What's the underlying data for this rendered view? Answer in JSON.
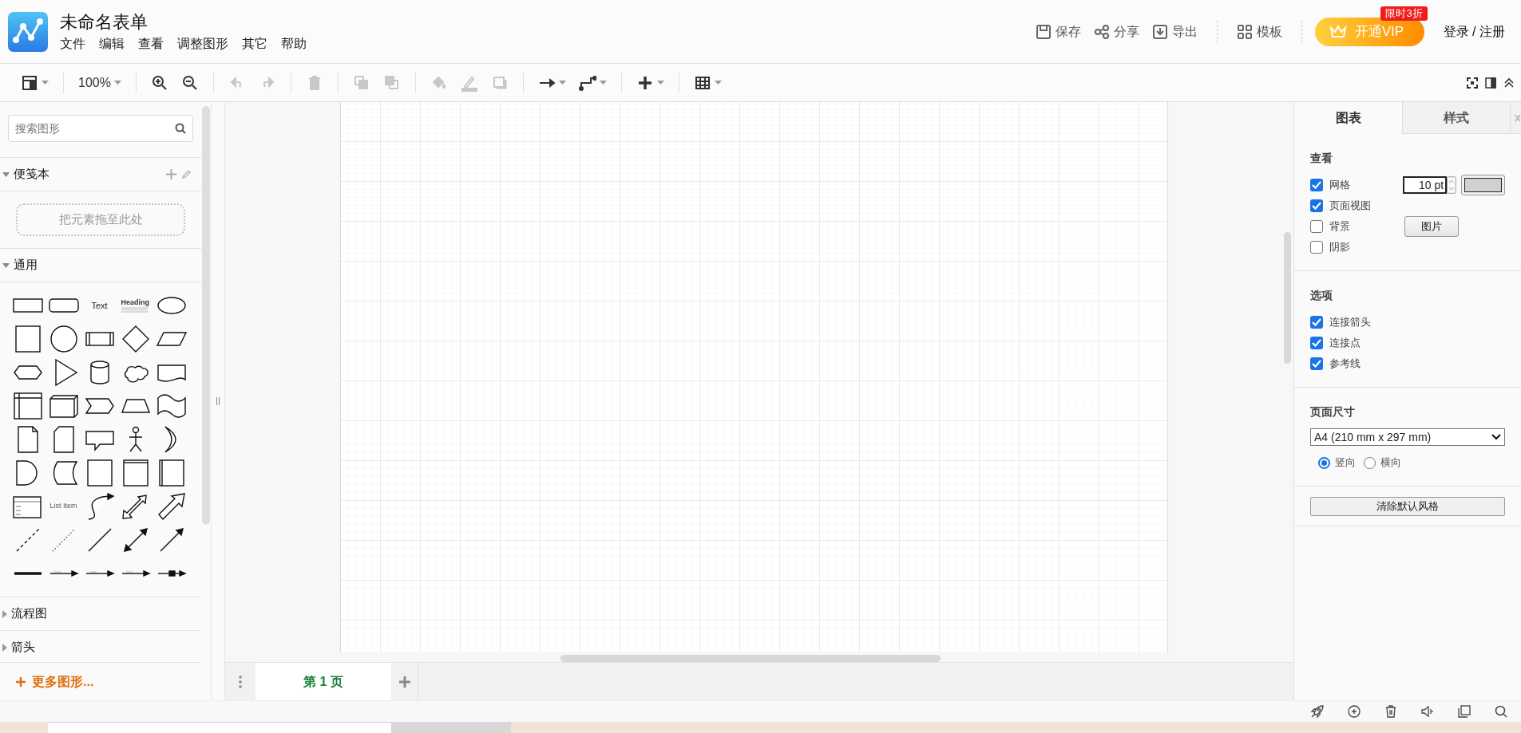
{
  "app": {
    "title": "未命名表单"
  },
  "menu": [
    "文件",
    "编辑",
    "查看",
    "调整图形",
    "其它",
    "帮助"
  ],
  "header_actions": [
    {
      "kind": "save",
      "label": "保存"
    },
    {
      "kind": "share",
      "label": "分享"
    },
    {
      "kind": "export",
      "label": "导出"
    },
    {
      "kind": "templates",
      "label": "模板"
    }
  ],
  "vip_button": {
    "label": "开通VIP",
    "badge": "限时3折"
  },
  "login": "登录 / 注册",
  "toolbar": [
    {
      "kind": "layout",
      "disabled": false
    },
    {
      "kind": "separator"
    },
    {
      "kind": "zoom",
      "label": "100%",
      "disabled": false
    },
    {
      "kind": "separator"
    },
    {
      "kind": "zoomin",
      "disabled": false
    },
    {
      "kind": "zoomout",
      "disabled": false
    },
    {
      "kind": "separator"
    },
    {
      "kind": "undo",
      "disabled": true
    },
    {
      "kind": "redo",
      "disabled": true
    },
    {
      "kind": "separator"
    },
    {
      "kind": "delete",
      "disabled": true
    },
    {
      "kind": "separator"
    },
    {
      "kind": "tofront",
      "disabled": true
    },
    {
      "kind": "toback",
      "disabled": true
    },
    {
      "kind": "separator"
    },
    {
      "kind": "fill",
      "disabled": true
    },
    {
      "kind": "linecolor",
      "disabled": true
    },
    {
      "kind": "shadow",
      "disabled": true
    },
    {
      "kind": "separator"
    },
    {
      "kind": "connection",
      "disabled": false
    },
    {
      "kind": "waypoints",
      "disabled": false
    },
    {
      "kind": "separator"
    },
    {
      "kind": "insert",
      "disabled": false
    },
    {
      "kind": "separator"
    },
    {
      "kind": "table",
      "disabled": false
    }
  ],
  "sidebar": {
    "search_placeholder": "搜索图形",
    "sections": [
      {
        "kind": "scratchpad",
        "title": "便笺本",
        "expanded": true,
        "drop_hint": "把元素拖至此处"
      },
      {
        "kind": "shapes",
        "title": "通用",
        "expanded": true,
        "shapes": [
          {
            "kind": "rect"
          },
          {
            "kind": "rounded"
          },
          {
            "kind": "text",
            "label": "Text"
          },
          {
            "kind": "heading",
            "label": "Heading"
          },
          {
            "kind": "ellipse"
          },
          {
            "kind": "square"
          },
          {
            "kind": "circle"
          },
          {
            "kind": "process"
          },
          {
            "kind": "diamond"
          },
          {
            "kind": "parallelogram"
          },
          {
            "kind": "hexagon"
          },
          {
            "kind": "triangle"
          },
          {
            "kind": "cylinder"
          },
          {
            "kind": "cloud"
          },
          {
            "kind": "document"
          },
          {
            "kind": "internal"
          },
          {
            "kind": "cube"
          },
          {
            "kind": "step"
          },
          {
            "kind": "trapezoid"
          },
          {
            "kind": "tape"
          },
          {
            "kind": "note"
          },
          {
            "kind": "card"
          },
          {
            "kind": "callout"
          },
          {
            "kind": "actor"
          },
          {
            "kind": "or"
          },
          {
            "kind": "and"
          },
          {
            "kind": "storage"
          },
          {
            "kind": "container"
          },
          {
            "kind": "swimlane"
          },
          {
            "kind": "pool"
          },
          {
            "kind": "list"
          },
          {
            "kind": "label",
            "label": "List Item"
          },
          {
            "kind": "curve"
          },
          {
            "kind": "doublearrow"
          },
          {
            "kind": "blockarrow"
          },
          {
            "kind": "dashed"
          },
          {
            "kind": "dotted"
          },
          {
            "kind": "line"
          },
          {
            "kind": "bidirectional"
          },
          {
            "kind": "arrowline"
          },
          {
            "kind": "thick"
          },
          {
            "kind": "connector"
          },
          {
            "kind": "connector"
          },
          {
            "kind": "connector"
          },
          {
            "kind": "symbolconnector"
          }
        ]
      },
      {
        "kind": "folder",
        "title": "流程图",
        "expanded": false
      },
      {
        "kind": "folder",
        "title": "箭头",
        "expanded": false
      }
    ],
    "more_shapes": "更多图形..."
  },
  "page_tabs": [
    {
      "label": "第 1 页",
      "selected": true
    }
  ],
  "format_panel": {
    "tabs": [
      {
        "label": "图表",
        "selected": true
      },
      {
        "label": "样式",
        "selected": false
      }
    ],
    "view": {
      "title": "查看",
      "options": [
        {
          "kind": "grid",
          "label": "网格",
          "checked": true,
          "value": "10 pt"
        },
        {
          "kind": "plain",
          "label": "页面视图",
          "checked": true
        },
        {
          "kind": "background",
          "label": "背景",
          "checked": false,
          "button": "图片"
        },
        {
          "kind": "plain",
          "label": "阴影",
          "checked": false
        }
      ]
    },
    "options": {
      "title": "选项",
      "items": [
        {
          "label": "连接箭头",
          "checked": true
        },
        {
          "label": "连接点",
          "checked": true
        },
        {
          "label": "参考线",
          "checked": true
        }
      ]
    },
    "page_size": {
      "title": "页面尺寸",
      "value": "A4 (210 mm x 297 mm)",
      "orientations": [
        {
          "label": "竖向",
          "selected": true
        },
        {
          "label": "横向",
          "selected": false
        }
      ]
    },
    "reset_button": "清除默认风格"
  }
}
